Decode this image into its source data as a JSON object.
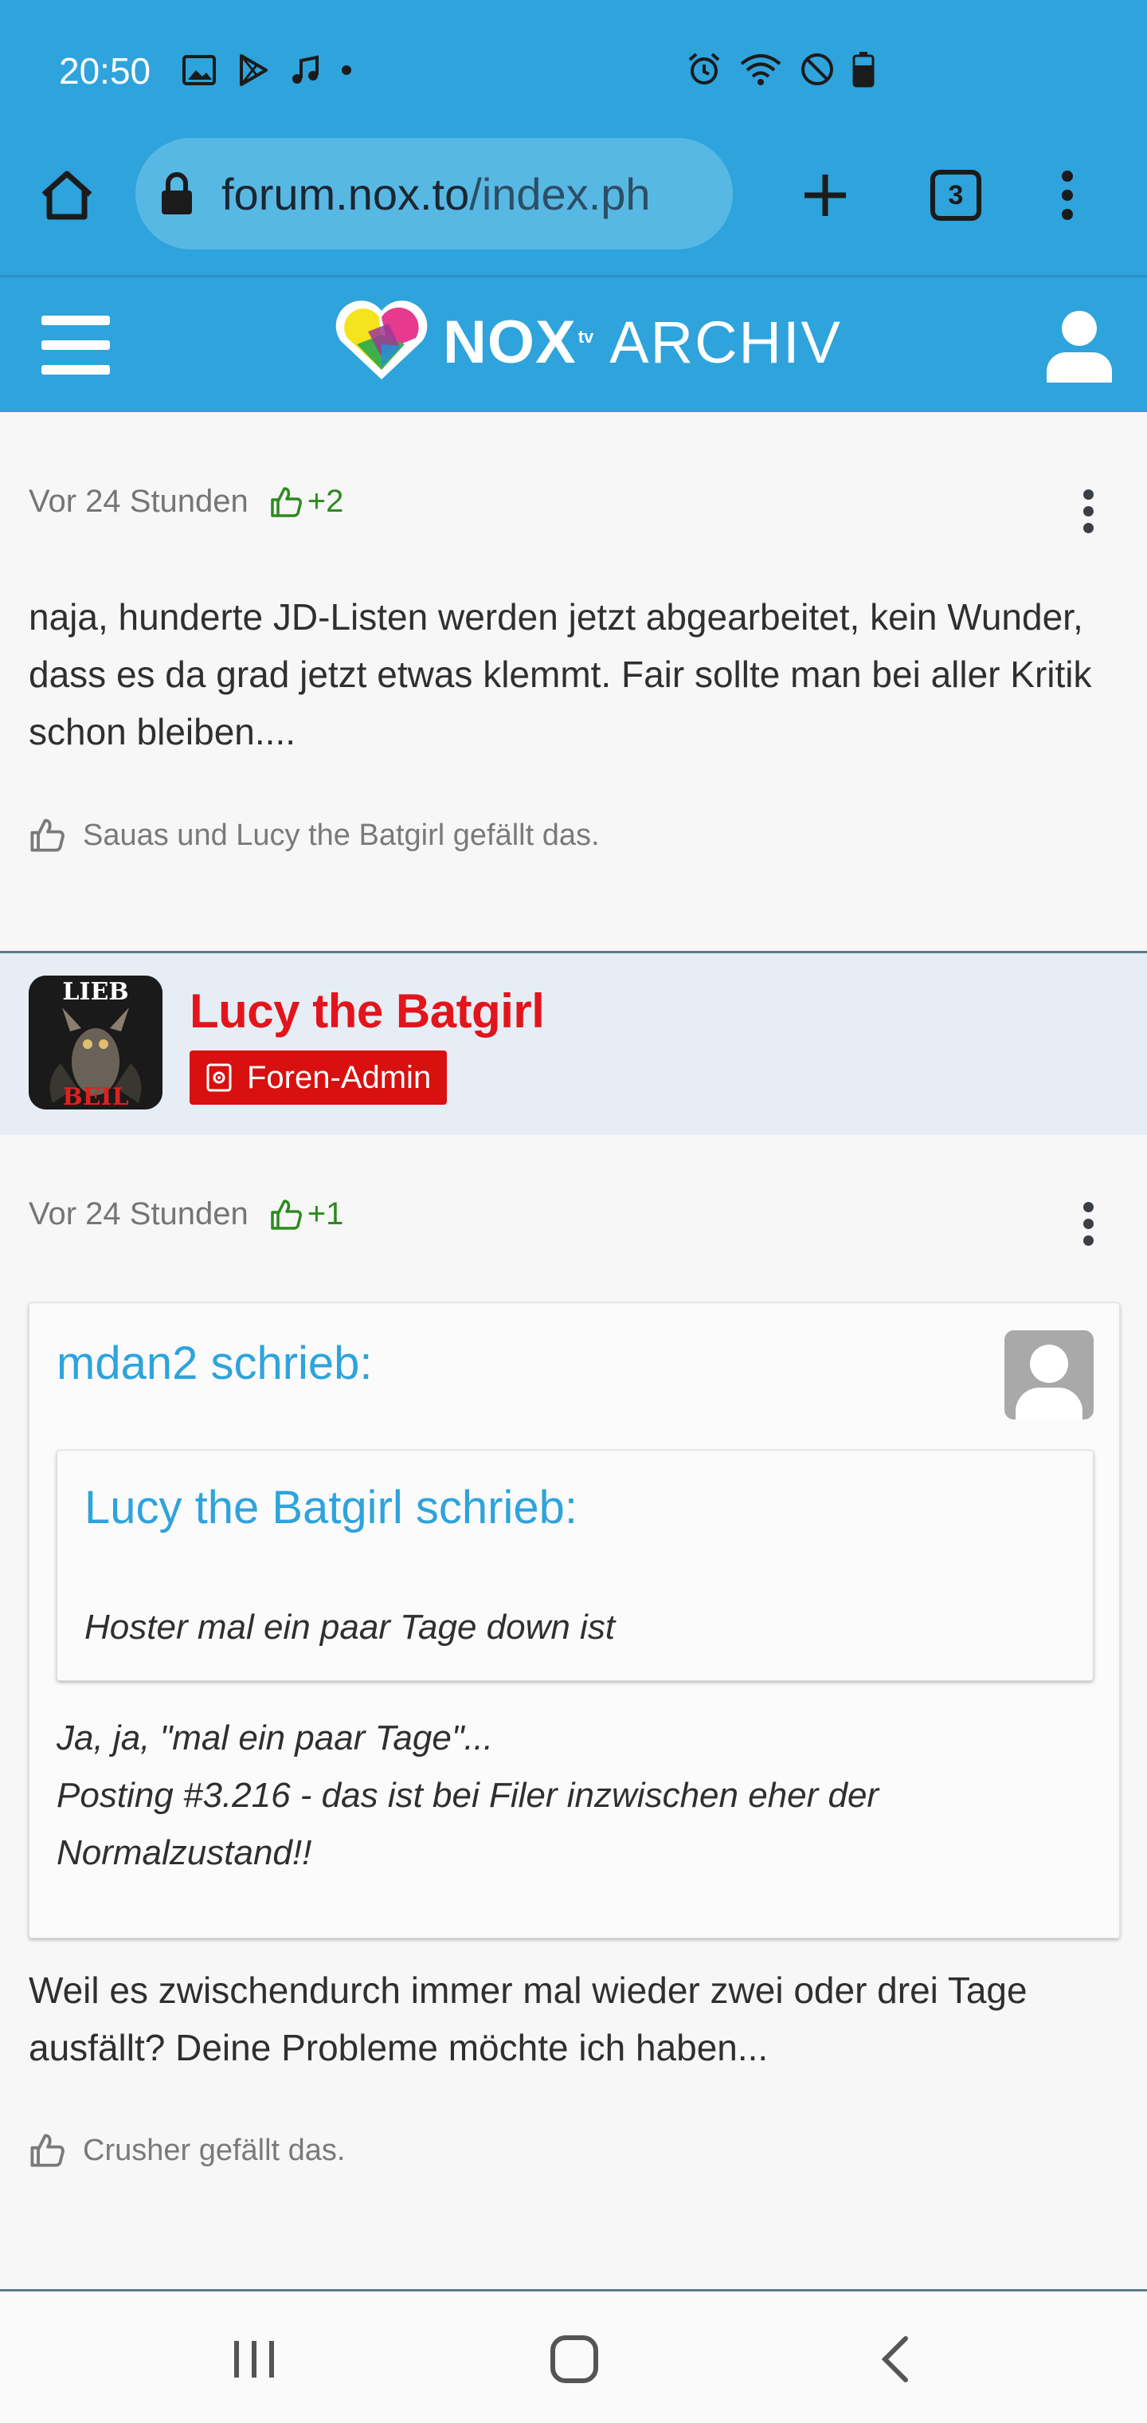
{
  "status_bar": {
    "time": "20:50",
    "left_icons": [
      "image-icon",
      "play-store-icon",
      "music-icon",
      "dot-icon"
    ],
    "right_icons": [
      "alarm-icon",
      "wifi-icon",
      "do-not-disturb-icon",
      "battery-icon"
    ]
  },
  "browser": {
    "url_domain": "forum.nox.to",
    "url_path": "/index.ph",
    "tab_count": "3"
  },
  "site": {
    "logo_text": "NOX",
    "logo_tv": "tv",
    "logo_archiv": "ARCHIV"
  },
  "posts": [
    {
      "time": "Vor 24 Stunden",
      "likes": "+2",
      "text": "naja, hunderte JD-Listen werden jetzt abgearbeitet, kein Wunder, dass es da grad jetzt etwas klemmt. Fair sollte man bei aller Kritik schon bleiben....",
      "reaction": "Sauas und Lucy the Batgirl gefällt das."
    },
    {
      "author": "Lucy the Batgirl",
      "role": "Foren-Admin",
      "avatar_text_top": "LIEB",
      "avatar_text_bottom": "BEIL",
      "time": "Vor 24 Stunden",
      "likes": "+1",
      "quote": {
        "title": "mdan2 schrieb:",
        "inner_title": "Lucy the Batgirl schrieb:",
        "inner_text": "Hoster mal ein paar Tage down ist",
        "text_line1": "Ja, ja, \"mal ein paar Tage\"...",
        "text_line2": "Posting #3.216 - das ist bei Filer inzwischen eher der",
        "text_line3": "Normalzustand!!"
      },
      "text": "Weil es zwischendurch immer mal wieder zwei oder drei Tage ausfällt? Deine Probleme möchte ich haben...",
      "reaction": "Crusher gefällt das."
    }
  ],
  "nav": [
    "recent-apps-icon",
    "home-icon",
    "back-icon"
  ],
  "colors": {
    "header_blue": "#2ea3dc",
    "admin_red": "#d8100f",
    "like_green": "#2d8a1f"
  }
}
